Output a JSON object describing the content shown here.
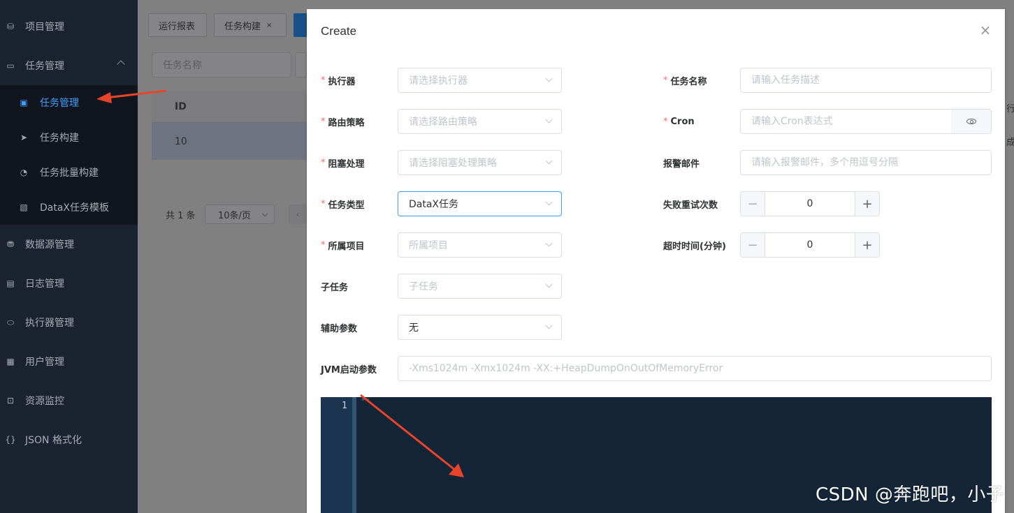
{
  "sidebar": {
    "items": [
      {
        "label": "项目管理",
        "icon": "database-icon",
        "glyph": "⛁"
      },
      {
        "label": "任务管理",
        "icon": "monitor-icon",
        "glyph": "▭"
      },
      {
        "label": "数据源管理",
        "icon": "datasource-icon",
        "glyph": "⛃"
      },
      {
        "label": "日志管理",
        "icon": "document-icon",
        "glyph": "▤"
      },
      {
        "label": "执行器管理",
        "icon": "cpu-icon",
        "glyph": "⬭"
      },
      {
        "label": "用户管理",
        "icon": "grid-icon",
        "glyph": "▦"
      },
      {
        "label": "资源监控",
        "icon": "monitor-eye-icon",
        "glyph": "⊡"
      },
      {
        "label": "JSON 格式化",
        "icon": "braces-icon",
        "glyph": "{}"
      }
    ],
    "submenu": [
      {
        "label": "任务管理",
        "icon": "calendar-icon",
        "glyph": "▣",
        "active": true
      },
      {
        "label": "任务构建",
        "icon": "send-icon",
        "glyph": "➤"
      },
      {
        "label": "任务批量构建",
        "icon": "dashboard-icon",
        "glyph": "◔"
      },
      {
        "label": "DataX任务模板",
        "icon": "clipboard-icon",
        "glyph": "▧"
      }
    ]
  },
  "background": {
    "tags": [
      {
        "label": "运行报表"
      },
      {
        "label": "任务构建",
        "close": "×"
      }
    ],
    "search_placeholder": "任务名称",
    "table": {
      "header_id": "ID",
      "row_id": "10"
    },
    "pagination": {
      "total": "共 1 条",
      "page_size": "10条/页",
      "prev": "‹"
    },
    "right_partial_header": "行",
    "right_partial_cell": "成"
  },
  "dialog": {
    "title": "Create",
    "close": "×",
    "left_fields": [
      {
        "label": "执行器",
        "required": true,
        "placeholder": "请选择执行器",
        "value": ""
      },
      {
        "label": "路由策略",
        "required": true,
        "placeholder": "请选择路由策略",
        "value": ""
      },
      {
        "label": "阻塞处理",
        "required": true,
        "placeholder": "请选择阻塞处理策略",
        "value": ""
      },
      {
        "label": "任务类型",
        "required": true,
        "placeholder": "",
        "value": "DataX任务"
      },
      {
        "label": "所属项目",
        "required": true,
        "placeholder": "所属项目",
        "value": ""
      },
      {
        "label": "子任务",
        "required": false,
        "placeholder": "子任务",
        "value": ""
      },
      {
        "label": "辅助参数",
        "required": false,
        "placeholder": "",
        "value": "无"
      }
    ],
    "right_fields": {
      "task_name": {
        "label": "任务名称",
        "required": true,
        "placeholder": "请输入任务描述"
      },
      "cron": {
        "label": "Cron",
        "required": true,
        "placeholder": "请输入Cron表达式"
      },
      "alarm_email": {
        "label": "报警邮件",
        "required": false,
        "placeholder": "请输入报警邮件，多个用逗号分隔"
      },
      "retry_count": {
        "label": "失败重试次数",
        "value": "0"
      },
      "timeout": {
        "label": "超时时间(分钟)",
        "value": "0"
      }
    },
    "jvm": {
      "label": "JVM启动参数",
      "placeholder": "-Xms1024m -Xmx1024m -XX:+HeapDumpOnOutOfMemoryError"
    },
    "editor": {
      "line_number": "1",
      "content": "\"\""
    },
    "stepper_minus": "−",
    "stepper_plus": "+"
  },
  "watermark": "CSDN @奔跑吧，小子",
  "colors": {
    "primary": "#409eff",
    "required": "#f56c6c",
    "annotation_arrow": "#e8442c"
  }
}
